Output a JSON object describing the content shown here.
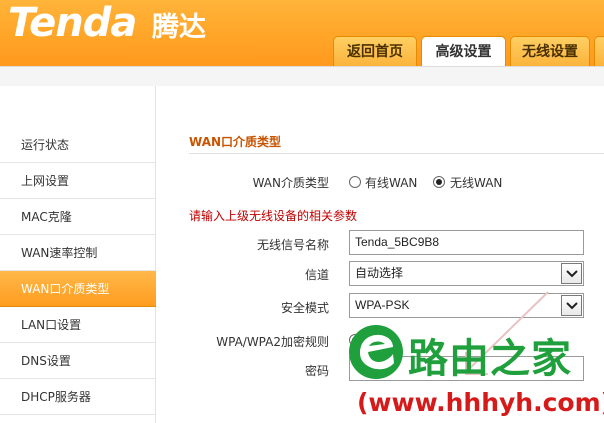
{
  "brand": {
    "logo": "Tenda",
    "logo_cn": "腾达"
  },
  "tabs": [
    {
      "label": "返回首页",
      "active": false
    },
    {
      "label": "高级设置",
      "active": true
    },
    {
      "label": "无线设置",
      "active": false
    }
  ],
  "sidebar": {
    "items": [
      {
        "label": "运行状态",
        "active": false
      },
      {
        "label": "上网设置",
        "active": false
      },
      {
        "label": "MAC克隆",
        "active": false
      },
      {
        "label": "WAN速率控制",
        "active": false
      },
      {
        "label": "WAN口介质类型",
        "active": true
      },
      {
        "label": "LAN口设置",
        "active": false
      },
      {
        "label": "DNS设置",
        "active": false
      },
      {
        "label": "DHCP服务器",
        "active": false
      }
    ]
  },
  "main": {
    "section_title": "WAN口介质类型",
    "media_type": {
      "label": "WAN介质类型",
      "options": [
        {
          "label": "有线WAN",
          "checked": false
        },
        {
          "label": "无线WAN",
          "checked": true
        }
      ]
    },
    "hint": "请输入上级无线设备的相关参数",
    "ssid": {
      "label": "无线信号名称",
      "value": "Tenda_5BC9B8"
    },
    "channel": {
      "label": "信道",
      "value": "自动选择"
    },
    "security": {
      "label": "安全模式",
      "value": "WPA-PSK"
    },
    "encryption": {
      "label": "WPA/WPA2加密规则"
    },
    "password": {
      "label": "密码"
    }
  },
  "watermark": {
    "text": "路由之家",
    "url": "(www.hhhyh.com)"
  },
  "colors": {
    "accent": "#ff9c1f",
    "section_title": "#c85400",
    "hint": "#c00000",
    "watermark_green": "#1fa03c",
    "watermark_red": "#d61a1a"
  }
}
